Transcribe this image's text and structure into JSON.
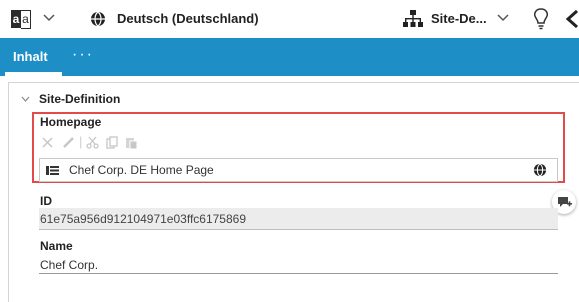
{
  "topbar": {
    "language_icon": {
      "left_glyph": "a",
      "right_glyph": "a"
    },
    "language_label": "Deutsch (Deutschland)",
    "site_label": "Site-De...",
    "icons": [
      "language-icon",
      "chevron-down-icon",
      "globe-icon",
      "sitemap-icon",
      "lightbulb-icon",
      "back-arrow-icon"
    ]
  },
  "tabs": {
    "active_label": "Inhalt",
    "more_label": "···"
  },
  "section": {
    "title": "Site-Definition"
  },
  "homepage": {
    "label": "Homepage",
    "link_text": "Chef Corp. DE Home Page",
    "toolbar_icons": [
      "remove-icon",
      "edit-icon",
      "cut-icon",
      "copy-icon",
      "paste-icon"
    ]
  },
  "id_field": {
    "label": "ID",
    "value": "61e75a956d912104971e03ffc6175869"
  },
  "name_field": {
    "label": "Name",
    "value": "Chef Corp."
  },
  "colors": {
    "tabbar": "#1e8fc6",
    "highlight": "#e34a4a"
  }
}
